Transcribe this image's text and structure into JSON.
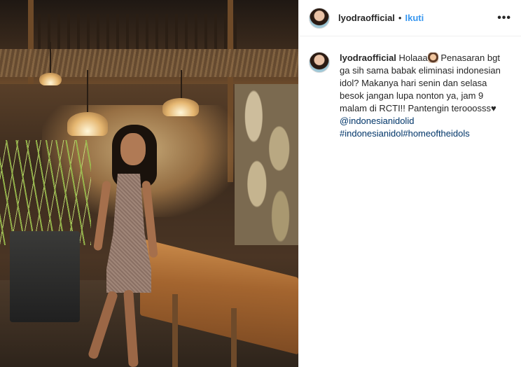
{
  "post": {
    "username": "lyodraofficial",
    "separator": "•",
    "follow_label": "Ikuti",
    "more_label": "•••"
  },
  "caption": {
    "username": "lyodraofficial",
    "text_before_emoji": "Holaaa",
    "emoji_icon": "woman-gesturing-emoji",
    "text_main": "Penasaran bgt ga sih sama babak eliminasi indonesian idol? Makanya hari senin dan selasa besok jangan lupa nonton ya, jam 9 malam di RCTI!! Pantengin terooosss",
    "heart": "♥",
    "mention": "@indonesianidolid",
    "hashtag1": "#indonesianidol",
    "hashtag2": "#homeoftheidols"
  },
  "colors": {
    "accent": "#3897f0",
    "link": "#003569",
    "text": "#262626",
    "border": "#efefef"
  }
}
